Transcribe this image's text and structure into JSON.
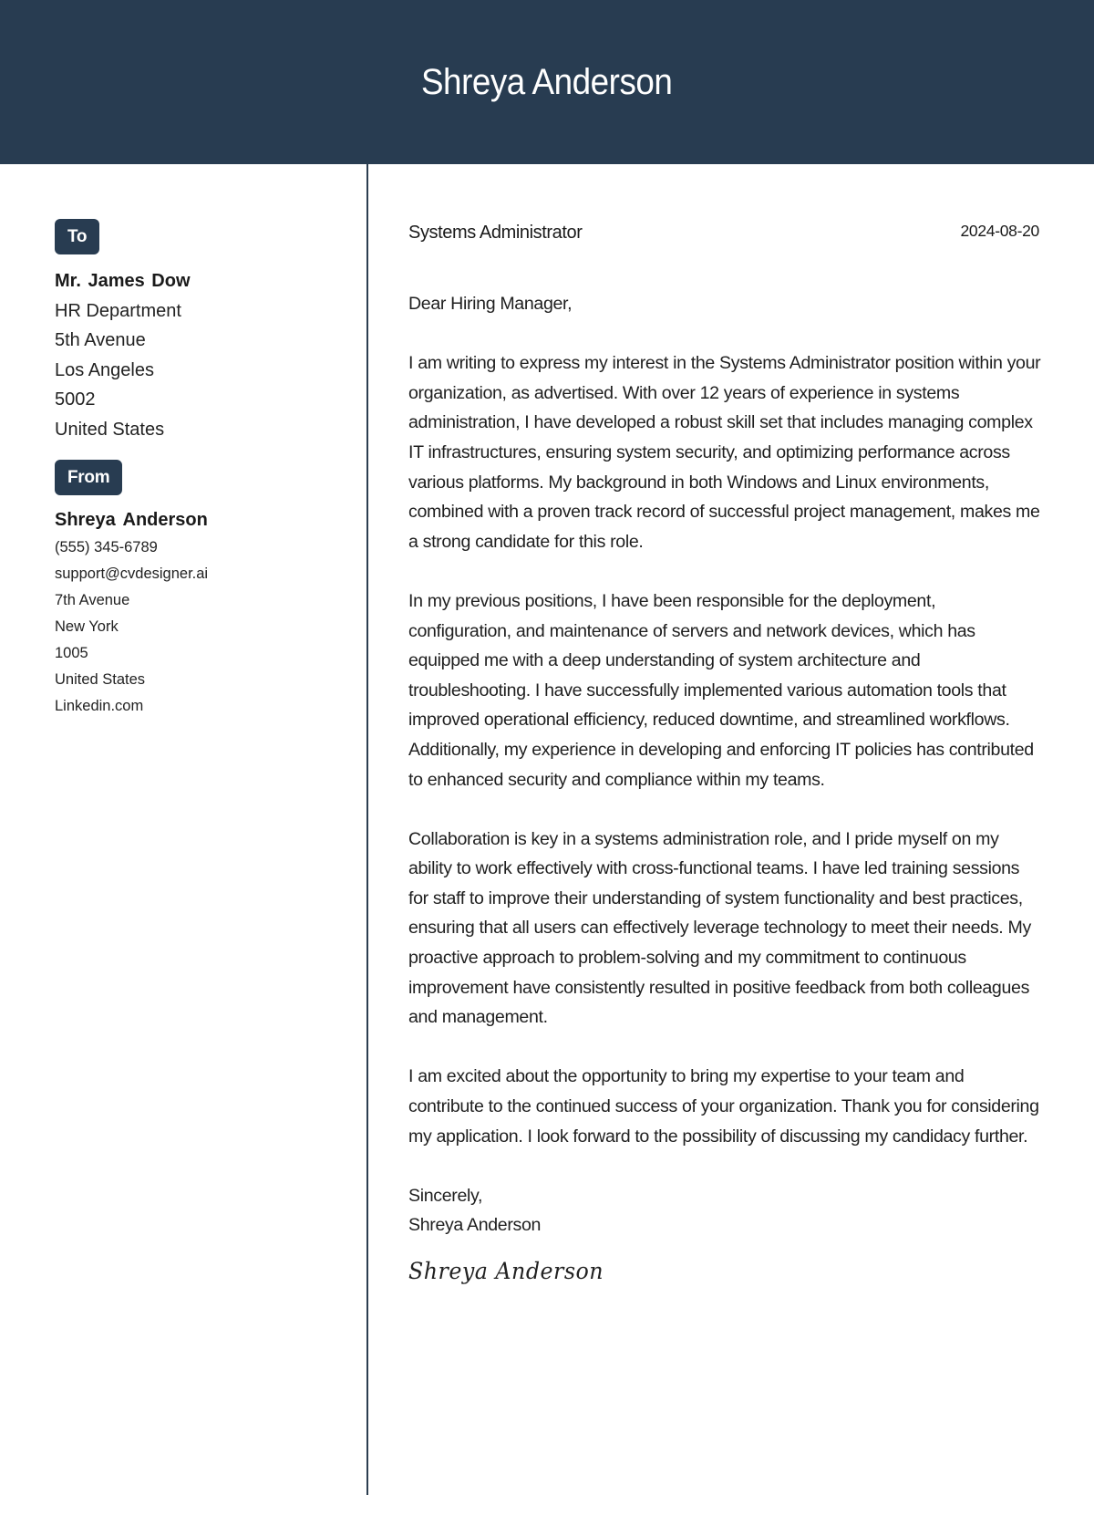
{
  "header": {
    "name": "Shreya Anderson",
    "background_color": "#283c51"
  },
  "recipient": {
    "badge_label": "To",
    "name": "Mr. James Dow",
    "lines": [
      "HR Department",
      "5th Avenue",
      "Los Angeles",
      "5002",
      "United States"
    ]
  },
  "sender": {
    "badge_label": "From",
    "name": "Shreya Anderson",
    "phone": "(555) 345-6789",
    "email": "support@cvdesigner.ai",
    "street": "7th Avenue",
    "city": "New York",
    "zip": "1005",
    "country": "United States",
    "website": "Linkedin.com"
  },
  "letter": {
    "job_title": "Systems Administrator",
    "date": "2024-08-20",
    "greeting": "Dear Hiring Manager,",
    "paragraphs": [
      "I am writing to express my interest in the Systems Administrator position within your organization, as advertised. With over 12 years of experience in systems administration, I have developed a robust skill set that includes managing complex IT infrastructures, ensuring system security, and optimizing performance across various platforms. My background in both Windows and Linux environments, combined with a proven track record of successful project management, makes me a strong candidate for this role.",
      "In my previous positions, I have been responsible for the deployment, configuration, and maintenance of servers and network devices, which has equipped me with a deep understanding of system architecture and troubleshooting. I have successfully implemented various automation tools that improved operational efficiency, reduced downtime, and streamlined workflows. Additionally, my experience in developing and enforcing IT policies has contributed to enhanced security and compliance within my teams.",
      "Collaboration is key in a systems administration role, and I pride myself on my ability to work effectively with cross-functional teams. I have led training sessions for staff to improve their understanding of system functionality and best practices, ensuring that all users can effectively leverage technology to meet their needs. My proactive approach to problem-solving and my commitment to continuous improvement have consistently resulted in positive feedback from both colleagues and management.",
      "I am excited about the opportunity to bring my expertise to your team and contribute to the continued success of your organization. Thank you for considering my application. I look forward to the possibility of discussing my candidacy further."
    ],
    "closing": "Sincerely,",
    "closing_name": "Shreya Anderson",
    "signature": "Shreya Anderson"
  }
}
